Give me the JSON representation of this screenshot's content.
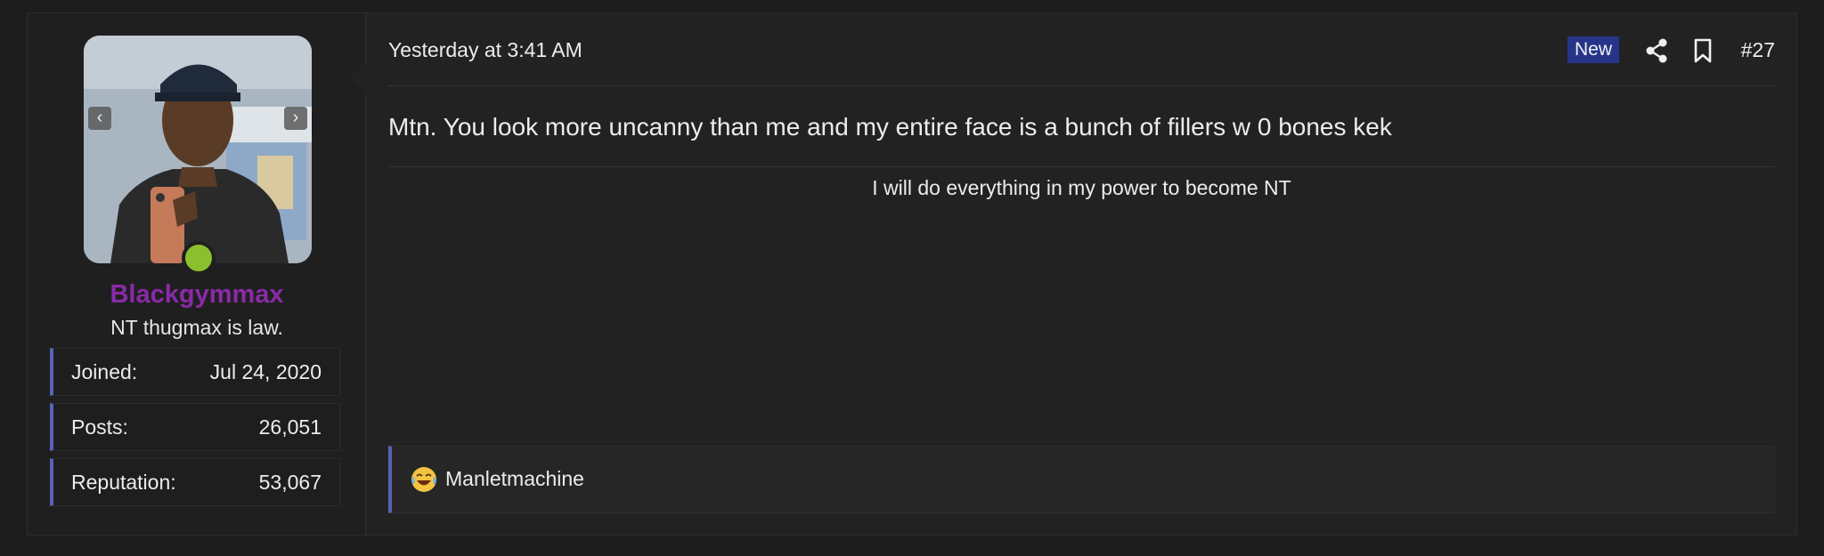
{
  "post": {
    "date": "Yesterday at 3:41 AM",
    "new_badge": "New",
    "post_number": "#27",
    "body": "Mtn. You look more uncanny than me and my entire face is a bunch of fillers w 0 bones kek",
    "signature": "I will do everything in my power to become NT"
  },
  "user": {
    "name": "Blackgymmax",
    "title": "NT thugmax is law.",
    "name_color": "#8a2aa8",
    "online_status_color": "#8bbf2e",
    "stats": [
      {
        "label": "Joined:",
        "value": "Jul 24, 2020"
      },
      {
        "label": "Posts:",
        "value": "26,051"
      },
      {
        "label": "Reputation:",
        "value": "53,067"
      }
    ]
  },
  "reactions": {
    "emoji_icon": "laughing-crying-emoji-icon",
    "users": "Manletmachine"
  },
  "icons": {
    "share": "share-icon",
    "bookmark": "bookmark-icon",
    "prev": "chevron-left-icon",
    "next": "chevron-right-icon"
  },
  "colors": {
    "accent": "#5763b6",
    "badge_bg": "#26358a"
  }
}
